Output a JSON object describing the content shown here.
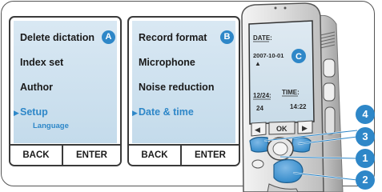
{
  "panel_a": {
    "badge": "A",
    "items": [
      "Delete dictation",
      "Index set",
      "Author",
      "Setup"
    ],
    "selected_sub": "Language",
    "softkeys": {
      "left": "BACK",
      "right": "ENTER"
    }
  },
  "panel_b": {
    "badge": "B",
    "items": [
      "Record format",
      "Microphone",
      "Noise reduction",
      "Date & time"
    ],
    "softkeys": {
      "left": "BACK",
      "right": "ENTER"
    }
  },
  "device": {
    "badge": "C",
    "screen": {
      "date_label": "DATE:",
      "date_value": "2007-10-01",
      "date12_label": "12/24:",
      "date12_value": "24",
      "time_label": "TIME:",
      "time_value": "14:22",
      "ok_label": "OK"
    }
  },
  "callouts": [
    "4",
    "3",
    "1",
    "2"
  ],
  "colors": {
    "accent": "#2e87c8",
    "lcd": "#cfe2ef",
    "border": "#3a3a3a"
  }
}
